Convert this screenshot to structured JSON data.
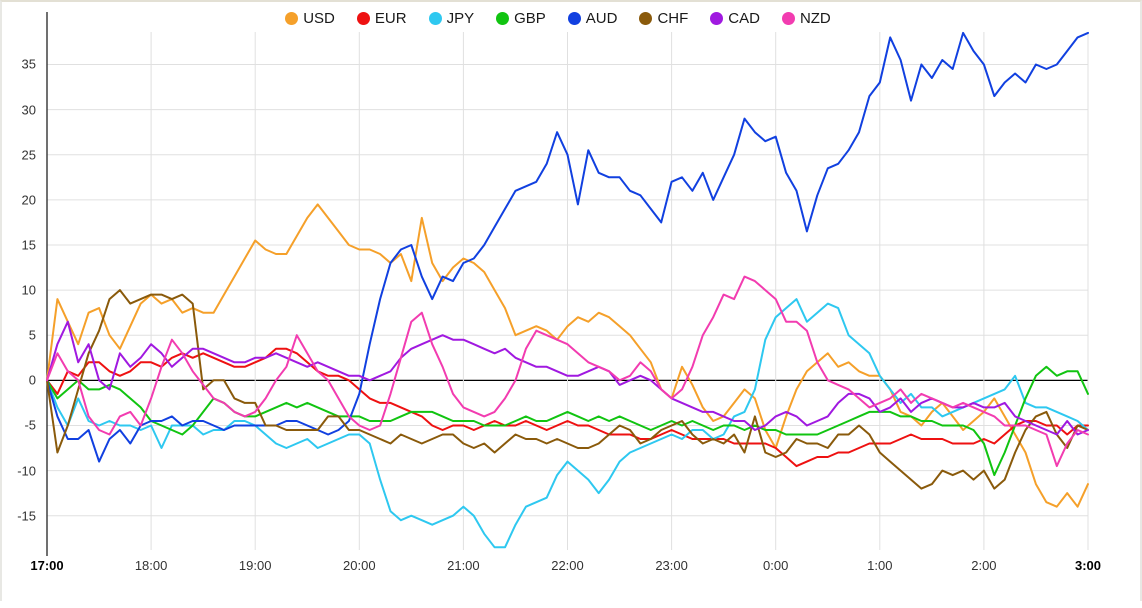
{
  "legend": {
    "position": "top-center",
    "items": [
      {
        "label": "USD",
        "color": "#f5a02a"
      },
      {
        "label": "EUR",
        "color": "#ee1111"
      },
      {
        "label": "JPY",
        "color": "#2ec8f0"
      },
      {
        "label": "GBP",
        "color": "#11c411"
      },
      {
        "label": "AUD",
        "color": "#1140e0"
      },
      {
        "label": "CHF",
        "color": "#8a5a0b"
      },
      {
        "label": "CAD",
        "color": "#a019e0"
      },
      {
        "label": "NZD",
        "color": "#f23cb0"
      }
    ]
  },
  "axes": {
    "y_ticks": [
      35,
      30,
      25,
      20,
      15,
      10,
      5,
      0,
      -5,
      -10,
      -15
    ],
    "y_min": -18.8,
    "y_max": 38.6,
    "x_ticks": [
      "17:00",
      "18:00",
      "19:00",
      "20:00",
      "21:00",
      "22:00",
      "23:00",
      "0:00",
      "1:00",
      "2:00",
      "3:00"
    ],
    "x_bold_ticks": [
      "17:00",
      "3:00"
    ],
    "zero_line_color": "#000000",
    "grid_color": "#e0e0e0",
    "grid": true
  },
  "chart_data": {
    "type": "line",
    "title": "",
    "xlabel": "",
    "ylabel": "",
    "ylim": [
      -18.8,
      38.6
    ],
    "xlim": [
      "17:00",
      "3:00"
    ],
    "grid": true,
    "legend_position": "top-center",
    "x": [
      "17:00",
      "17:06",
      "17:12",
      "17:18",
      "17:24",
      "17:30",
      "17:36",
      "17:42",
      "17:48",
      "17:54",
      "18:00",
      "18:06",
      "18:12",
      "18:18",
      "18:24",
      "18:30",
      "18:36",
      "18:42",
      "18:48",
      "18:54",
      "19:00",
      "19:06",
      "19:12",
      "19:18",
      "19:24",
      "19:30",
      "19:36",
      "19:42",
      "19:48",
      "19:54",
      "20:00",
      "20:06",
      "20:12",
      "20:18",
      "20:24",
      "20:30",
      "20:36",
      "20:42",
      "20:48",
      "20:54",
      "21:00",
      "21:06",
      "21:12",
      "21:18",
      "21:24",
      "21:30",
      "21:36",
      "21:42",
      "21:48",
      "21:54",
      "22:00",
      "22:06",
      "22:12",
      "22:18",
      "22:24",
      "22:30",
      "22:36",
      "22:42",
      "22:48",
      "22:54",
      "23:00",
      "23:06",
      "23:12",
      "23:18",
      "23:24",
      "23:30",
      "23:36",
      "23:42",
      "23:48",
      "23:54",
      "0:00",
      "0:06",
      "0:12",
      "0:18",
      "0:24",
      "0:30",
      "0:36",
      "0:42",
      "0:48",
      "0:54",
      "1:00",
      "1:06",
      "1:12",
      "1:18",
      "1:24",
      "1:30",
      "1:36",
      "1:42",
      "1:48",
      "1:54",
      "2:00",
      "2:06",
      "2:12",
      "2:18",
      "2:24",
      "2:30",
      "2:36",
      "2:42",
      "2:48",
      "2:54",
      "3:00"
    ],
    "series": [
      {
        "name": "USD",
        "color": "#f5a02a",
        "values": [
          0,
          9,
          6.5,
          4,
          7.5,
          8,
          5,
          3.5,
          6,
          8.5,
          9.5,
          8.5,
          9,
          7.5,
          8,
          7.5,
          7.5,
          9.5,
          11.5,
          13.5,
          15.5,
          14.5,
          14,
          14,
          16,
          18,
          19.5,
          18,
          16.5,
          15,
          14.5,
          14.5,
          14,
          13,
          14,
          11,
          18,
          13,
          11,
          12.5,
          13.5,
          13,
          12,
          10,
          8,
          5,
          5.5,
          6,
          5.5,
          4.5,
          6,
          7,
          6.5,
          7.5,
          7,
          6,
          5,
          3.5,
          2,
          -1,
          -2,
          1.5,
          -0.5,
          -3,
          -4.5,
          -4,
          -2.5,
          -1,
          -2,
          -5.5,
          -7.5,
          -4,
          -1,
          1,
          2,
          3,
          1.5,
          2,
          1,
          0.5,
          0.5,
          -1,
          -3.5,
          -4,
          -5,
          -3.5,
          -2.5,
          -4,
          -5.5,
          -4.5,
          -3.5,
          -2,
          -4,
          -6,
          -8,
          -11.5,
          -13.5,
          -14,
          -12.5,
          -14,
          -11.5
        ]
      },
      {
        "name": "EUR",
        "color": "#ee1111",
        "values": [
          0,
          -1.5,
          1,
          0.5,
          2,
          2,
          1,
          0.5,
          1,
          2,
          2,
          1.5,
          2.5,
          3,
          2.5,
          3,
          2.5,
          2,
          1.5,
          1.5,
          2,
          2.5,
          3.5,
          3.5,
          3,
          2,
          1,
          0.5,
          0.5,
          0,
          -1,
          -2,
          -2.5,
          -2.5,
          -3,
          -3.5,
          -4,
          -5,
          -5.5,
          -5,
          -5,
          -5.5,
          -5,
          -4.5,
          -5,
          -5,
          -4.5,
          -5,
          -5.5,
          -5,
          -4.5,
          -5,
          -5,
          -5.5,
          -6,
          -6,
          -6,
          -6.5,
          -6.5,
          -6,
          -5.5,
          -6,
          -6.5,
          -6.5,
          -6.5,
          -6.5,
          -7,
          -7,
          -7,
          -7,
          -7.5,
          -8.5,
          -9.5,
          -9,
          -8.5,
          -8.5,
          -8,
          -8,
          -7.5,
          -7,
          -7,
          -7,
          -6.5,
          -6,
          -6.5,
          -6.5,
          -6.5,
          -7,
          -7,
          -7,
          -6.5,
          -7,
          -6,
          -5,
          -4.5,
          -4.5,
          -5,
          -5,
          -6,
          -5,
          -5
        ]
      },
      {
        "name": "JPY",
        "color": "#2ec8f0",
        "values": [
          0,
          -3,
          -5,
          -2,
          -4.5,
          -5,
          -4.5,
          -5,
          -5,
          -5.5,
          -5,
          -7.5,
          -5,
          -5,
          -5,
          -6,
          -5.5,
          -5.5,
          -4.5,
          -4.5,
          -5,
          -6,
          -7,
          -7.5,
          -7,
          -6.5,
          -7.5,
          -7,
          -6.5,
          -6,
          -6,
          -7,
          -11,
          -14.5,
          -15.5,
          -15,
          -15.5,
          -16,
          -15.5,
          -15,
          -14,
          -15,
          -17,
          -18.5,
          -18.5,
          -16,
          -14,
          -13.5,
          -13,
          -10.5,
          -9,
          -10,
          -11,
          -12.5,
          -11,
          -9,
          -8,
          -7.5,
          -7,
          -6.5,
          -6,
          -6.5,
          -5.5,
          -5.5,
          -6.5,
          -6,
          -4,
          -3.5,
          -1,
          4.5,
          7,
          8,
          9,
          6.5,
          7.5,
          8.5,
          8,
          5,
          4,
          3,
          0.5,
          -1,
          -2.5,
          -1.5,
          -3,
          -3,
          -4,
          -3.5,
          -3,
          -2.5,
          -2,
          -1.5,
          -1,
          0.5,
          -2.5,
          -3,
          -3,
          -3.5,
          -4,
          -4.5,
          -5.5
        ]
      },
      {
        "name": "GBP",
        "color": "#11c411",
        "values": [
          0,
          -2,
          -1,
          0,
          -1,
          -1,
          -0.5,
          -1,
          -2,
          -3,
          -4.5,
          -5,
          -5.5,
          -6,
          -5,
          -3.5,
          -2,
          -2.5,
          -3.5,
          -4,
          -4,
          -3.5,
          -3,
          -2.5,
          -3,
          -2.5,
          -3,
          -3.5,
          -4,
          -4,
          -4,
          -4.5,
          -4.5,
          -4.5,
          -4,
          -3.5,
          -3.5,
          -3.5,
          -4,
          -4.5,
          -4.5,
          -4.5,
          -5,
          -5,
          -5,
          -4.5,
          -4,
          -4.5,
          -4.5,
          -4,
          -3.5,
          -4,
          -4.5,
          -4,
          -4.5,
          -4,
          -4.5,
          -5,
          -5.5,
          -5,
          -4.5,
          -5,
          -4.5,
          -5,
          -5.5,
          -5,
          -5,
          -5.5,
          -5,
          -5.5,
          -5.5,
          -6,
          -6,
          -6,
          -6,
          -5.5,
          -5,
          -4.5,
          -4,
          -3.5,
          -3.5,
          -3.5,
          -4,
          -4,
          -4.5,
          -4.5,
          -5,
          -5,
          -5,
          -5.5,
          -7,
          -10.5,
          -8,
          -5,
          -2,
          0.5,
          1.5,
          0.5,
          1,
          1,
          -1.5
        ]
      },
      {
        "name": "AUD",
        "color": "#1140e0",
        "values": [
          0,
          -4,
          -6.5,
          -6.5,
          -5.5,
          -9,
          -6.5,
          -5.5,
          -7,
          -5,
          -4.5,
          -4.5,
          -4,
          -5,
          -4.5,
          -4.5,
          -5,
          -5.5,
          -5,
          -5,
          -5,
          -5,
          -5,
          -4.5,
          -4.5,
          -5,
          -5.5,
          -6,
          -5.5,
          -4.5,
          -1.5,
          4,
          9,
          13,
          14.5,
          15,
          11.5,
          9,
          11.5,
          11,
          13,
          13.5,
          15,
          17,
          19,
          21,
          21.5,
          22,
          24,
          27.5,
          25,
          19.5,
          25.5,
          23,
          22.5,
          22.5,
          21,
          20.5,
          19,
          17.5,
          22,
          22.5,
          21,
          23,
          20,
          22.5,
          25,
          29,
          27.5,
          26.5,
          27,
          23,
          21,
          16.5,
          20.5,
          23.5,
          24,
          25.5,
          27.5,
          31.5,
          33,
          38,
          35.5,
          31,
          35,
          33.5,
          35.5,
          34.5,
          38.5,
          36.5,
          35,
          31.5,
          33,
          34,
          33,
          35,
          34.5,
          35,
          36.5,
          38,
          38.5
        ]
      },
      {
        "name": "CHF",
        "color": "#8a5a0b",
        "values": [
          0,
          -8,
          -5,
          -1,
          3,
          5.5,
          9,
          10,
          8.5,
          9,
          9.5,
          9.5,
          9,
          9.5,
          8.5,
          -1,
          0,
          0,
          -2,
          -2.5,
          -2.5,
          -5,
          -5,
          -5.5,
          -5.5,
          -5.5,
          -5.5,
          -4,
          -4,
          -5.5,
          -5.5,
          -6,
          -6.5,
          -7,
          -6,
          -6.5,
          -7,
          -6.5,
          -6,
          -6,
          -7,
          -7.5,
          -7,
          -8,
          -7,
          -6,
          -6.5,
          -6.5,
          -7,
          -6.5,
          -7,
          -7.5,
          -7.5,
          -7,
          -6,
          -5,
          -5.5,
          -7,
          -6.5,
          -5.5,
          -5,
          -4.5,
          -6,
          -7,
          -6.5,
          -7,
          -6,
          -8,
          -4,
          -8,
          -8.5,
          -8,
          -6.5,
          -7,
          -7,
          -7.5,
          -6,
          -6,
          -5,
          -6,
          -8,
          -9,
          -10,
          -11,
          -12,
          -11.5,
          -10,
          -10.5,
          -10,
          -11,
          -10,
          -12,
          -11,
          -8,
          -5.5,
          -4,
          -3.5,
          -6,
          -7.5,
          -5,
          -5.5
        ]
      },
      {
        "name": "CAD",
        "color": "#a019e0",
        "values": [
          0,
          4,
          6.5,
          2,
          4,
          0,
          -1,
          3,
          1.5,
          2.5,
          4,
          3,
          1.5,
          2.5,
          3.5,
          3.5,
          3,
          2.5,
          2,
          2,
          2.5,
          2.5,
          3,
          2.5,
          2,
          1.5,
          2,
          1.5,
          1,
          0.5,
          0.5,
          0,
          0.5,
          1,
          2.5,
          3.5,
          4,
          4.5,
          5,
          4.5,
          4.5,
          4,
          3.5,
          3,
          3.5,
          2.5,
          2,
          1.5,
          1.5,
          1,
          0.5,
          0.5,
          1,
          1.5,
          1,
          -0.5,
          0,
          0.5,
          0,
          -1,
          -2,
          -2.5,
          -3,
          -3.5,
          -3.5,
          -4,
          -4.5,
          -4.5,
          -5.5,
          -5,
          -4,
          -3.5,
          -4,
          -5,
          -4.5,
          -4,
          -2.5,
          -1.5,
          -1.5,
          -2,
          -3.5,
          -3,
          -2,
          -3.5,
          -2.5,
          -2,
          -2.5,
          -3,
          -3,
          -2.5,
          -3,
          -3,
          -2.5,
          -4,
          -4.5,
          -5,
          -5.5,
          -6,
          -4.5,
          -6,
          -5.5
        ]
      },
      {
        "name": "NZD",
        "color": "#f23cb0",
        "values": [
          0,
          3,
          1,
          0,
          -4,
          -5.5,
          -6,
          -4,
          -3.5,
          -5,
          -2,
          1.5,
          4.5,
          3,
          1,
          -0.5,
          -2,
          -2.5,
          -3.5,
          -4,
          -3.5,
          -2,
          0,
          1.5,
          5,
          3,
          1,
          0,
          -2,
          -4,
          -5,
          -5.5,
          -5,
          -1.5,
          2.5,
          6.5,
          7.5,
          4,
          1.5,
          -1.5,
          -3,
          -3.5,
          -4,
          -3.5,
          -2,
          0,
          3.5,
          5.5,
          5,
          4.5,
          4,
          3,
          2,
          1.5,
          1,
          0,
          0.5,
          2,
          1,
          -1,
          -2,
          -1,
          1.5,
          5,
          7,
          9.5,
          9,
          11.5,
          11,
          10,
          9,
          6.5,
          6.5,
          5.5,
          2,
          0,
          -0.5,
          -1,
          -2,
          -3,
          -2.5,
          -2,
          -1,
          -2.5,
          -1.5,
          -2,
          -2.5,
          -3,
          -2.5,
          -3,
          -3.5,
          -4,
          -5,
          -5,
          -5,
          -5.5,
          -6,
          -9.5,
          -7,
          -5.5,
          -6
        ]
      }
    ]
  }
}
